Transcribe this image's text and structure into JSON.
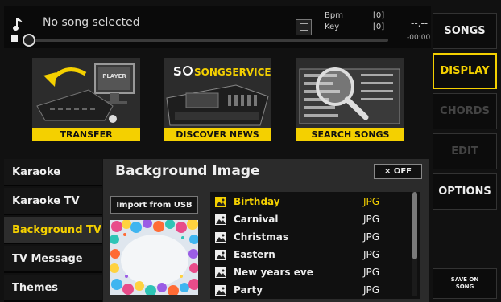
{
  "player": {
    "song_title": "No song selected",
    "bpm_label": "Bpm",
    "bpm_value": "[0]",
    "key_label": "Key",
    "key_value": "[0]",
    "time_dashes": "--.--",
    "time_remaining": "-00:00",
    "progress": 0
  },
  "banners": {
    "transfer": "TRANSFER",
    "discover": "DISCOVER NEWS",
    "search": "SEARCH SONGS",
    "song_service_text": "SONGSERVICE"
  },
  "right_panel": {
    "songs": "SONGS",
    "display": "DISPLAY",
    "chords": "CHORDS",
    "edit": "EDIT",
    "options": "OPTIONS",
    "save_on_song_line1": "SAVE ON",
    "save_on_song_line2": "SONG"
  },
  "left_nav": {
    "items": [
      "Karaoke",
      "Karaoke TV",
      "Background TV",
      "TV Message",
      "Themes"
    ],
    "active": "Background TV"
  },
  "content": {
    "title": "Background Image",
    "off_button": "× OFF",
    "import_button": "Import from USB",
    "files": [
      {
        "name": "Birthday",
        "type": "JPG"
      },
      {
        "name": "Carnival",
        "type": "JPG"
      },
      {
        "name": "Christmas",
        "type": "JPG"
      },
      {
        "name": "Eastern",
        "type": "JPG"
      },
      {
        "name": "New years eve",
        "type": "JPG"
      },
      {
        "name": "Party",
        "type": "JPG"
      }
    ],
    "selected_file": "Birthday"
  },
  "colors": {
    "accent": "#f4d000",
    "background": "#111111",
    "panel": "#2b2b2b"
  }
}
